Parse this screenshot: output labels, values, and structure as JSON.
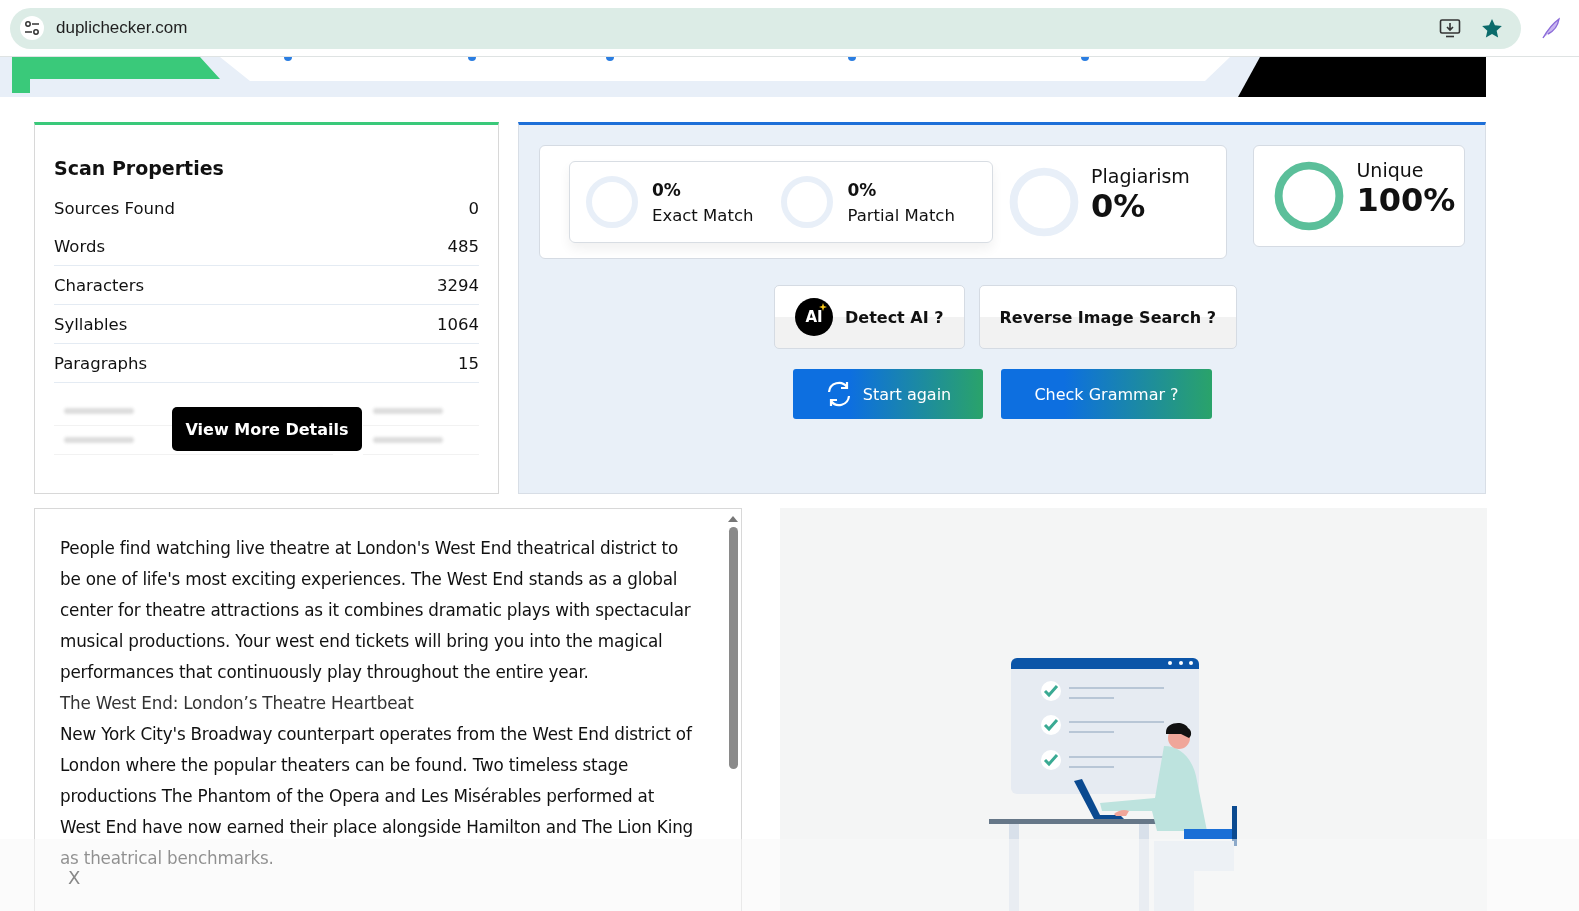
{
  "browser": {
    "url": "duplichecker.com"
  },
  "scan_properties": {
    "title": "Scan Properties",
    "rows": [
      {
        "label": "Sources Found",
        "value": "0"
      },
      {
        "label": "Words",
        "value": "485"
      },
      {
        "label": "Characters",
        "value": "3294"
      },
      {
        "label": "Syllables",
        "value": "1064"
      },
      {
        "label": "Paragraphs",
        "value": "15"
      }
    ],
    "button": "View More Details"
  },
  "results": {
    "matches": [
      {
        "percent": "0%",
        "label": "Exact Match"
      },
      {
        "percent": "0%",
        "label": "Partial Match"
      }
    ],
    "plagiarism": {
      "label": "Plagiarism",
      "percent": "0%"
    },
    "unique": {
      "label": "Unique",
      "percent": "100%"
    }
  },
  "tool_buttons": [
    {
      "label": "Detect AI ?",
      "kind": "ai",
      "icon_text": "AI"
    },
    {
      "label": "Reverse Image Search ?",
      "kind": "plain"
    }
  ],
  "action_buttons": [
    {
      "label": "Start again",
      "kind": "refresh"
    },
    {
      "label": "Check Grammar ?",
      "kind": "plain"
    }
  ],
  "text": [
    {
      "kind": "body",
      "text": "People find watching live theatre at London's West End theatrical district to be one of life's most exciting experiences. The West End stands as a global center for theatre attractions as it combines dramatic plays with spectacular musical productions. Your west end tickets will bring you into the magical performances that continuously play throughout the entire year."
    },
    {
      "kind": "heading",
      "text": "The West End: London’s Theatre Heartbeat"
    },
    {
      "kind": "body",
      "text": "New York City's Broadway counterpart operates from the West End district of London where the popular theaters can be found. Two timeless stage productions The Phantom of the Opera and Les Misérables performed at West End have now earned their place alongside Hamilton and The Lion King as theatrical benchmarks."
    }
  ],
  "overlay": {
    "close": "X"
  }
}
